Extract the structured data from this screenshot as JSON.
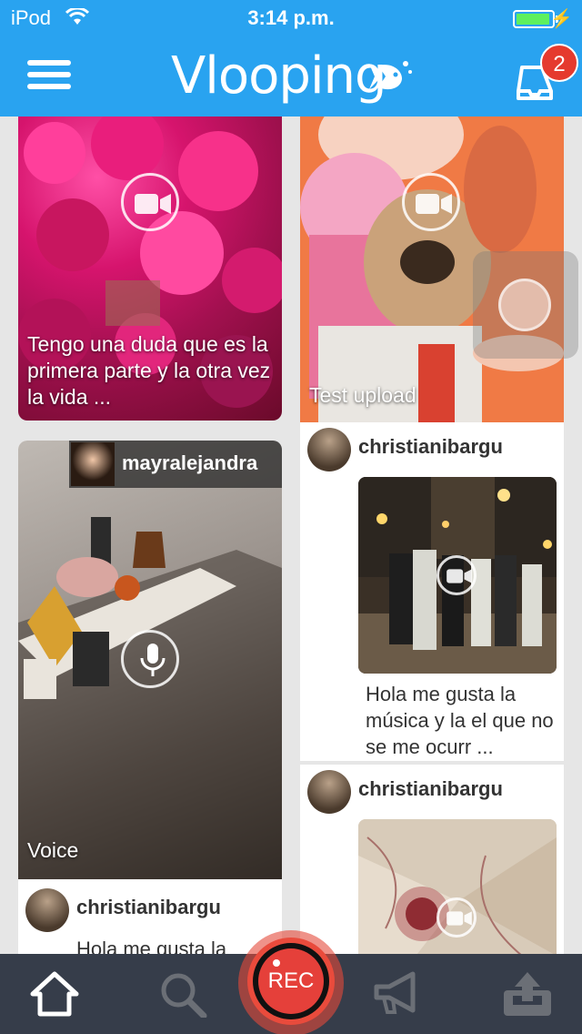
{
  "status_bar": {
    "carrier": "iPod",
    "time": "3:14 p.m.",
    "battery_level": 0.95,
    "battery_color": "#5ef05e"
  },
  "header": {
    "logo_text": "Vlooping",
    "menu_icon": "hamburger-icon",
    "notifications_icon": "inbox-icon",
    "notifications_count": "2",
    "brand_color": "#29a3f0",
    "badge_color": "#e53a2e"
  },
  "feed": {
    "cards": [
      {
        "caption": "Tengo una duda que es la primera parte y la otra vez la vida ...",
        "type_icon": "video-camera-icon"
      },
      {
        "caption": "Test upload",
        "type_icon": "video-camera-icon"
      },
      {
        "username": "mayralejandra",
        "caption": "Voice",
        "type_icon": "microphone-icon"
      },
      {
        "username": "christianibargu",
        "text": "Hola me gusta la música y la el que no se me ocurr ...",
        "type_icon": "video-camera-icon"
      },
      {
        "username": "christianibargu",
        "type_icon": "video-camera-icon"
      },
      {
        "username": "christianibargu",
        "text": "Hola me gusta la"
      }
    ]
  },
  "tab_bar": {
    "home_icon": "home-icon",
    "search_icon": "search-icon",
    "rec_label": "REC",
    "announce_icon": "megaphone-icon",
    "upload_icon": "upload-icon",
    "rec_color": "#e5403a"
  }
}
